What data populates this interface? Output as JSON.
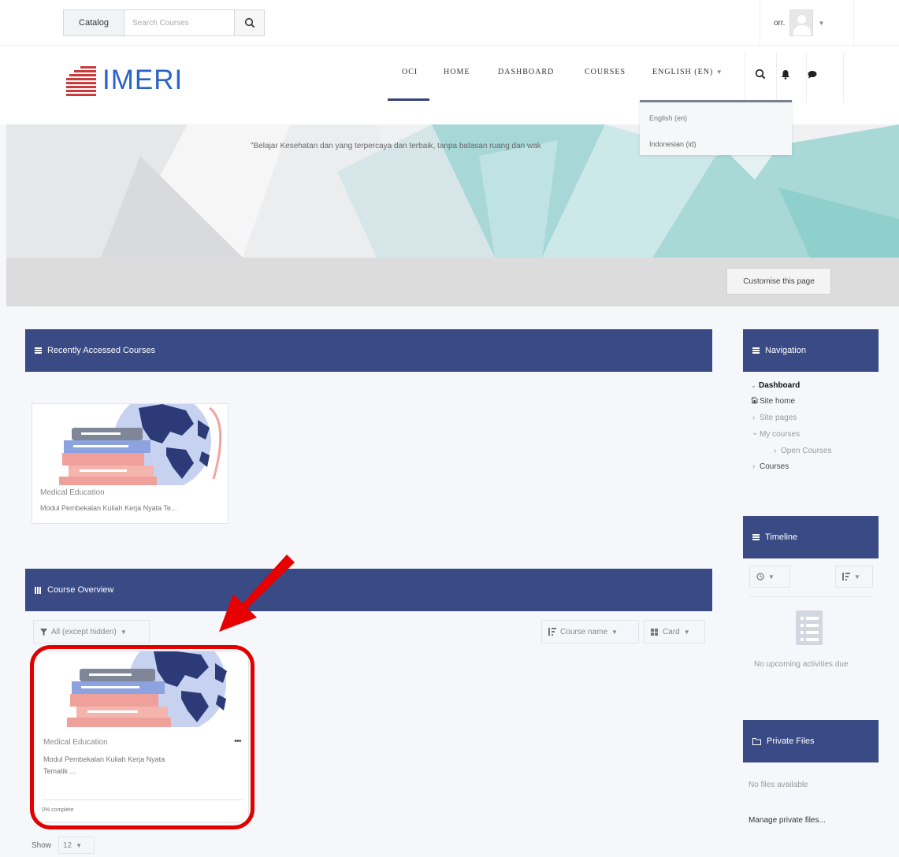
{
  "topbar": {
    "catalog_label": "Catalog",
    "search_placeholder": "Search Courses",
    "username": "orr."
  },
  "navbar": {
    "logo_text": "IMERI",
    "links": [
      "OCI",
      "HOME",
      "DASHBOARD",
      "COURSES",
      "ENGLISH (EN)"
    ],
    "active": "OCI"
  },
  "language_menu": {
    "items": [
      "English (en)",
      "Indonesian (id)"
    ]
  },
  "hero": {
    "tagline": "\"Belajar Kesehatan dan yang terpercaya dan terbaik, tanpa batasan ruang dan wak"
  },
  "customise_label": "Customise this page",
  "recent_block": {
    "title": "Recently Accessed Courses",
    "course": {
      "category": "Medical Education",
      "name": "Modul Pembekalan Kuliah Kerja Nyata Te..."
    }
  },
  "overview_block": {
    "title": "Course Overview",
    "filter_label": "All (except hidden)",
    "sort_label": "Course name",
    "view_label": "Card",
    "course": {
      "category": "Medical Education",
      "name_line1": "Modul Pembekalan Kuliah Kerja Nyata",
      "name_line2": "Tematik ...",
      "progress_label": "0% complete",
      "progress_percent": 0
    },
    "show_label": "Show",
    "show_value": "12"
  },
  "navigation_block": {
    "title": "Navigation",
    "items": {
      "dashboard": "Dashboard",
      "site_home": "Site home",
      "site_pages": "Site pages",
      "my_courses": "My courses",
      "open_courses": "Open Courses",
      "courses": "Courses"
    }
  },
  "timeline_block": {
    "title": "Timeline",
    "empty_text": "No upcoming activities due"
  },
  "files_block": {
    "title": "Private Files",
    "empty_text": "No files available",
    "manage_link": "Manage private files..."
  },
  "colors": {
    "block_header": "#3a4a85",
    "logo_blue": "#2a63c7",
    "logo_red": "#c83c3c",
    "highlight_red": "#e00000"
  }
}
